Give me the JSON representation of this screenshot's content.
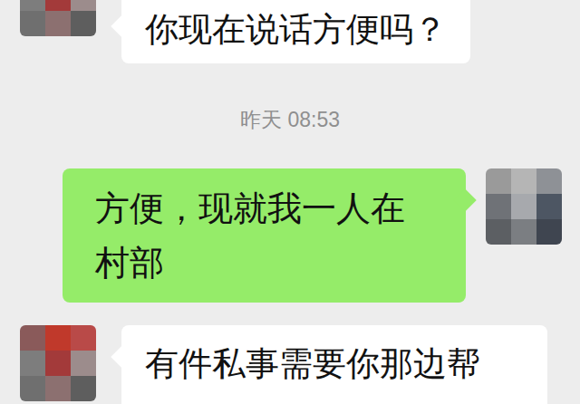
{
  "chat": {
    "messages": [
      {
        "kind": "received",
        "text": "你现在说话方便吗？"
      },
      {
        "kind": "time",
        "text": "昨天 08:53"
      },
      {
        "kind": "sent",
        "text": "方便，现就我一人在村部"
      },
      {
        "kind": "received",
        "text": "有件私事需要你那边帮"
      }
    ]
  }
}
